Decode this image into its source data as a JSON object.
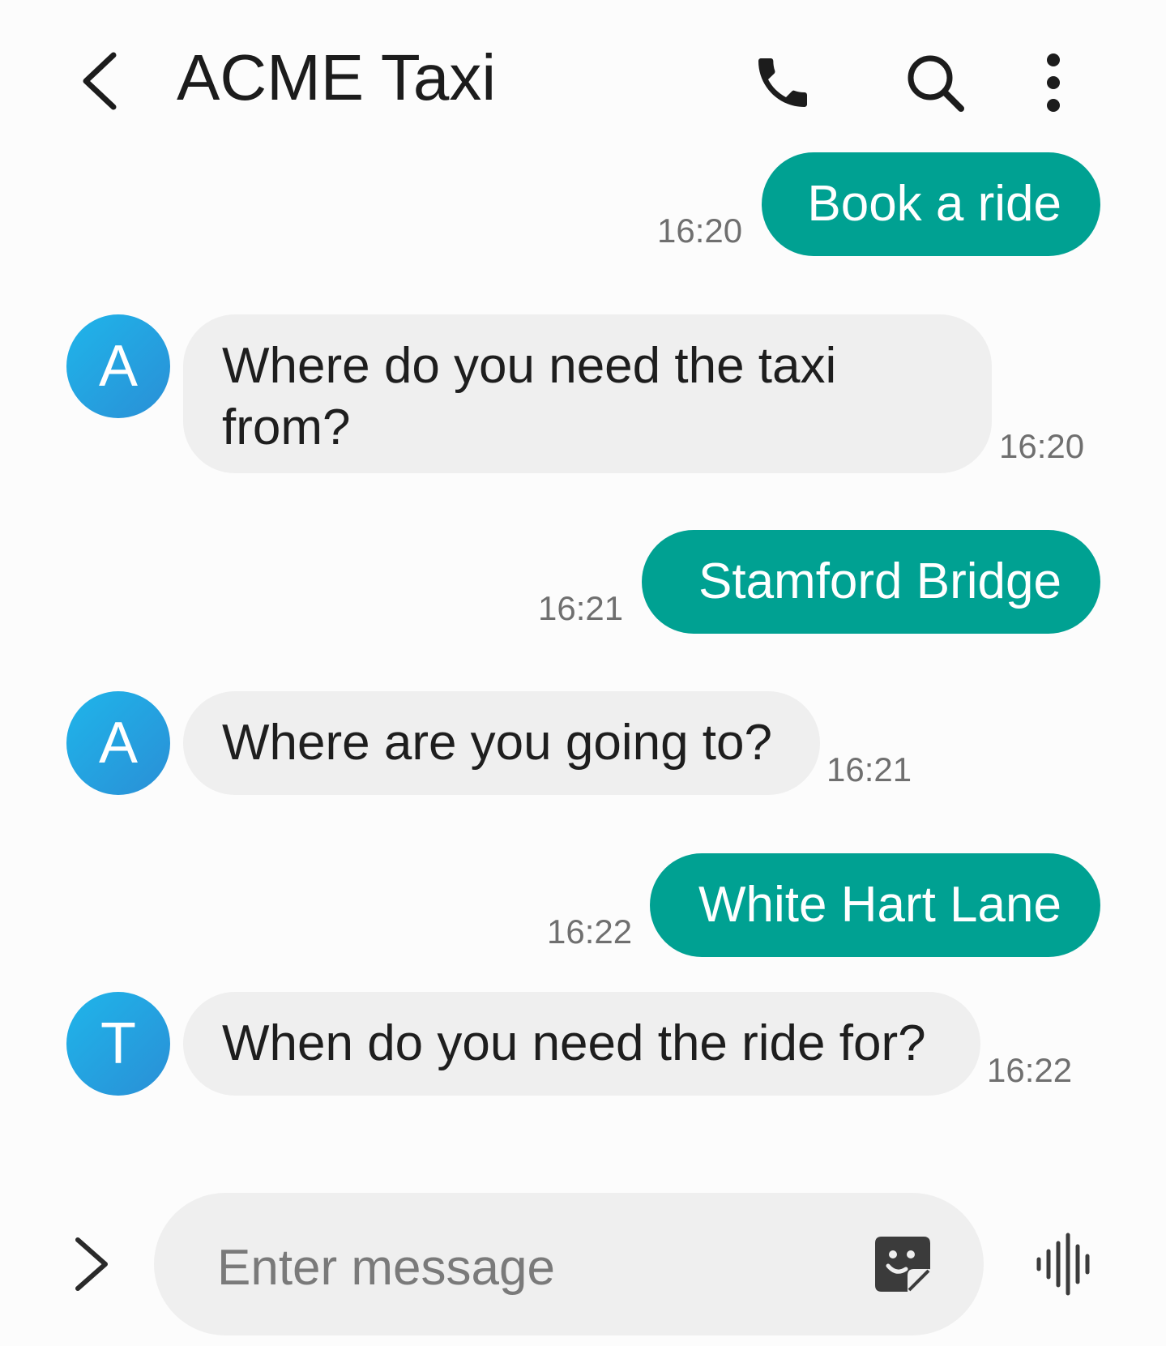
{
  "header": {
    "title": "ACME Taxi"
  },
  "icons": {
    "back": "chevron-left-icon",
    "call": "phone-icon",
    "search": "search-icon",
    "more": "more-vert-icon",
    "expand": "chevron-right-icon",
    "sticker": "sticker-icon",
    "voice": "voice-wave-icon"
  },
  "colors": {
    "outgoing_bubble": "#00a192",
    "incoming_bubble": "#efefef",
    "avatar": "#2a9de0"
  },
  "messages": [
    {
      "direction": "outgoing",
      "text": "Book a ride",
      "time": "16:20"
    },
    {
      "direction": "incoming",
      "avatar": "A",
      "text_line1": "Where do you need the taxi",
      "text_line2": "from?",
      "time": "16:20"
    },
    {
      "direction": "outgoing",
      "text": "Stamford Bridge",
      "time": "16:21"
    },
    {
      "direction": "incoming",
      "avatar": "A",
      "text": "Where are you going to?",
      "time": "16:21"
    },
    {
      "direction": "outgoing",
      "text": "White Hart Lane",
      "time": "16:22"
    },
    {
      "direction": "incoming",
      "avatar": "T",
      "text": "When do you need the ride for?",
      "time": "16:22"
    }
  ],
  "composer": {
    "placeholder": "Enter message",
    "value": ""
  }
}
